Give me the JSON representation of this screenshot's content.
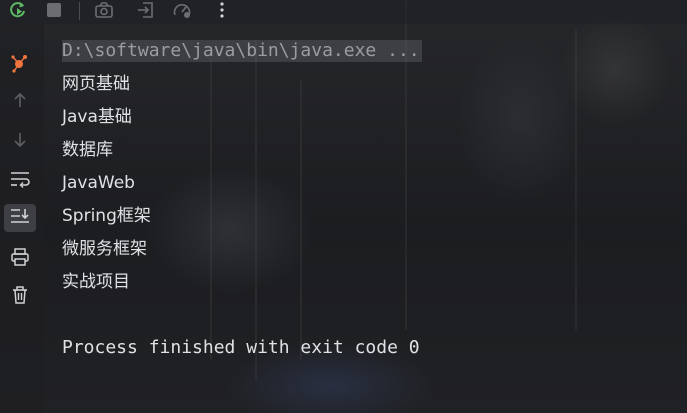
{
  "toolbar": {
    "buttons": [
      {
        "name": "rerun",
        "icon": "rerun-icon",
        "color": "#5fb865"
      },
      {
        "name": "stop",
        "icon": "stop-icon",
        "color": "#6b6d72"
      },
      {
        "name": "screenshot",
        "icon": "camera-icon",
        "color": "#6b6d72"
      },
      {
        "name": "exit",
        "icon": "exit-icon",
        "color": "#6b6d72"
      },
      {
        "name": "profiler",
        "icon": "gauge-icon",
        "color": "#6b6d72"
      },
      {
        "name": "more",
        "icon": "more-vertical-icon",
        "color": "#cfd1d6"
      }
    ]
  },
  "gutter": {
    "buttons": [
      {
        "name": "debug-sidebar",
        "icon": "debug-node-icon",
        "color": "#f0743d"
      },
      {
        "name": "scroll-up",
        "icon": "arrow-up-icon",
        "color": "#5d5f64"
      },
      {
        "name": "scroll-down",
        "icon": "arrow-down-icon",
        "color": "#5d5f64"
      },
      {
        "name": "soft-wrap",
        "icon": "soft-wrap-icon",
        "color": "#cfd1d6"
      },
      {
        "name": "scroll-to-end",
        "icon": "scroll-to-end-icon",
        "color": "#cfd1d6"
      },
      {
        "name": "print",
        "icon": "print-icon",
        "color": "#cfd1d6"
      },
      {
        "name": "clear",
        "icon": "trash-icon",
        "color": "#cfd1d6"
      }
    ]
  },
  "console": {
    "command": "D:\\software\\java\\bin\\java.exe ...",
    "output": [
      "网页基础",
      "Java基础",
      "数据库",
      "JavaWeb",
      "Spring框架",
      "微服务框架",
      "实战项目"
    ],
    "exit_message": "Process finished with exit code 0"
  }
}
